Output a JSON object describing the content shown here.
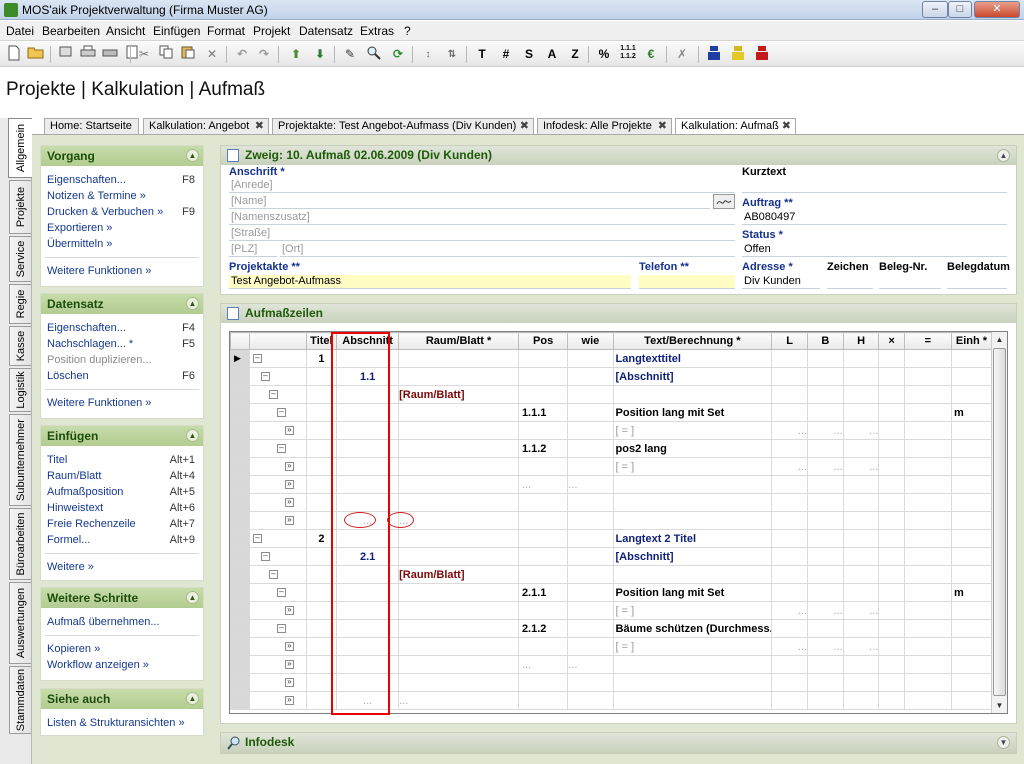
{
  "window": {
    "title": "MOS'aik Projektverwaltung (Firma Muster AG)",
    "min": "–",
    "max": "□",
    "close": "✕"
  },
  "menu": [
    "Datei",
    "Bearbeiten",
    "Ansicht",
    "Einfügen",
    "Format",
    "Projekt",
    "Datensatz",
    "Extras",
    "?"
  ],
  "toolbar": {
    "letters": [
      "T",
      "#",
      "S",
      "A",
      "Z",
      "%",
      "€"
    ]
  },
  "header": {
    "title": "Projekte | Kalkulation | Aufmaß"
  },
  "left_tabs": [
    "Allgemein",
    "Projekte",
    "Service",
    "Regie",
    "Kasse",
    "Logistik",
    "Subunternehmer",
    "Büroarbeiten",
    "Auswertungen",
    "Stammdaten"
  ],
  "tabs": [
    "Home: Startseite",
    "Kalkulation: Angebot",
    "Projektakte: Test Angebot-Aufmass (Div Kunden)",
    "Infodesk: Alle Projekte",
    "Kalkulation: Aufmaß"
  ],
  "sidebar": {
    "vorgang": {
      "title": "Vorgang",
      "items": [
        {
          "label": "Eigenschaften...",
          "key": "F8"
        },
        {
          "label": "Notizen & Termine »",
          "key": ""
        },
        {
          "label": "Drucken & Verbuchen »",
          "key": "F9"
        },
        {
          "label": "Exportieren »",
          "key": ""
        },
        {
          "label": "Übermitteln »",
          "key": ""
        }
      ],
      "more": "Weitere Funktionen »"
    },
    "datensatz": {
      "title": "Datensatz",
      "items": [
        {
          "label": "Eigenschaften...",
          "key": "F4"
        },
        {
          "label": "Nachschlagen... *",
          "key": "F5"
        },
        {
          "label": "Position duplizieren...",
          "key": ""
        },
        {
          "label": "Löschen",
          "key": "F6"
        }
      ],
      "more": "Weitere Funktionen »"
    },
    "einfuegen": {
      "title": "Einfügen",
      "items": [
        {
          "label": "Titel",
          "key": "Alt+1"
        },
        {
          "label": "Raum/Blatt",
          "key": "Alt+4"
        },
        {
          "label": "Aufmaßposition",
          "key": "Alt+5"
        },
        {
          "label": "Hinweistext",
          "key": "Alt+6"
        },
        {
          "label": "Freie Rechenzeile",
          "key": "Alt+7"
        },
        {
          "label": "Formel...",
          "key": "Alt+9"
        }
      ],
      "more": "Weitere »"
    },
    "schritte": {
      "title": "Weitere Schritte",
      "items": [
        "Aufmaß übernehmen...",
        "Kopieren »",
        "Workflow anzeigen »"
      ]
    },
    "siehe": {
      "title": "Siehe auch",
      "items": [
        "Listen & Strukturansichten »"
      ]
    }
  },
  "zweig": {
    "title": "Zweig: 10. Aufmaß 02.06.2009 (Div Kunden)",
    "anschrift_label": "Anschrift *",
    "anrede": "[Anrede]",
    "name": "[Name]",
    "namenszusatz": "[Namenszusatz]",
    "strasse": "[Straße]",
    "plz": "[PLZ]",
    "ort": "[Ort]",
    "kurztext_label": "Kurztext",
    "kurztext": "",
    "auftrag_label": "Auftrag **",
    "auftrag": "AB080497",
    "status_label": "Status *",
    "status": "Offen",
    "projektakte_label": "Projektakte **",
    "projektakte": "Test Angebot-Aufmass",
    "telefon_label": "Telefon **",
    "telefon": "",
    "adresse_label": "Adresse *",
    "adresse": "Div Kunden",
    "zeichen_label": "Zeichen",
    "zeichen": "",
    "belegnr_label": "Beleg-Nr.",
    "belegnr": "",
    "belegdatum_label": "Belegdatum",
    "belegdatum": ""
  },
  "aufmass": {
    "title": "Aufmaßzeilen",
    "columns": [
      "Titel",
      "Abschnitt",
      "Raum/Blatt *",
      "Pos",
      "wie",
      "Text/Berechnung *",
      "L",
      "B",
      "H",
      "×",
      "=",
      "Einh *"
    ],
    "rows": [
      {
        "titel": "1",
        "abschnitt": "",
        "raum": "",
        "pos": "",
        "wie": "",
        "text": "Langtexttitel",
        "einh": "",
        "style": "title"
      },
      {
        "titel": "",
        "abschnitt": "1.1",
        "raum": "",
        "pos": "",
        "wie": "",
        "text": "[Abschnitt]",
        "einh": "",
        "style": "title"
      },
      {
        "titel": "",
        "abschnitt": "",
        "raum": "[Raum/Blatt]",
        "pos": "",
        "wie": "",
        "text": "",
        "einh": "",
        "style": "raum"
      },
      {
        "titel": "",
        "abschnitt": "",
        "raum": "",
        "pos": "1.1.1",
        "wie": "",
        "text": "Position lang mit Set",
        "einh": "m",
        "style": "pos"
      },
      {
        "titel": "",
        "abschnitt": "",
        "raum": "",
        "pos": "",
        "wie": "",
        "text": "[ = ]",
        "einh": "",
        "style": "calc"
      },
      {
        "titel": "",
        "abschnitt": "",
        "raum": "",
        "pos": "1.1.2",
        "wie": "",
        "text": "pos2 lang",
        "einh": "",
        "style": "pos"
      },
      {
        "titel": "",
        "abschnitt": "",
        "raum": "",
        "pos": "",
        "wie": "",
        "text": "[ = ]",
        "einh": "",
        "style": "calc"
      },
      {
        "titel": "",
        "abschnitt": "",
        "raum": "",
        "pos": "...",
        "wie": "...",
        "text": "",
        "einh": "",
        "style": "empty"
      },
      {
        "titel": "",
        "abschnitt": "",
        "raum": "",
        "pos": "",
        "wie": "",
        "text": "",
        "einh": "",
        "style": "empty"
      },
      {
        "titel": "",
        "abschnitt": "...",
        "raum": "...",
        "pos": "",
        "wie": "",
        "text": "",
        "einh": "",
        "style": "empty"
      },
      {
        "titel": "2",
        "abschnitt": "",
        "raum": "",
        "pos": "",
        "wie": "",
        "text": "Langtext 2 Titel",
        "einh": "",
        "style": "title"
      },
      {
        "titel": "",
        "abschnitt": "2.1",
        "raum": "",
        "pos": "",
        "wie": "",
        "text": "[Abschnitt]",
        "einh": "",
        "style": "title"
      },
      {
        "titel": "",
        "abschnitt": "",
        "raum": "[Raum/Blatt]",
        "pos": "",
        "wie": "",
        "text": "",
        "einh": "",
        "style": "raum"
      },
      {
        "titel": "",
        "abschnitt": "",
        "raum": "",
        "pos": "2.1.1",
        "wie": "",
        "text": "Position lang mit Set",
        "einh": "m",
        "style": "pos"
      },
      {
        "titel": "",
        "abschnitt": "",
        "raum": "",
        "pos": "",
        "wie": "",
        "text": "[ = ]",
        "einh": "",
        "style": "calc"
      },
      {
        "titel": "",
        "abschnitt": "",
        "raum": "",
        "pos": "2.1.2",
        "wie": "",
        "text": "Bäume schützen (Durchmess...",
        "einh": "",
        "style": "pos"
      },
      {
        "titel": "",
        "abschnitt": "",
        "raum": "",
        "pos": "",
        "wie": "",
        "text": "[ = ]",
        "einh": "",
        "style": "calc"
      },
      {
        "titel": "",
        "abschnitt": "",
        "raum": "",
        "pos": "...",
        "wie": "...",
        "text": "",
        "einh": "",
        "style": "empty"
      },
      {
        "titel": "",
        "abschnitt": "",
        "raum": "",
        "pos": "",
        "wie": "",
        "text": "",
        "einh": "",
        "style": "empty"
      },
      {
        "titel": "",
        "abschnitt": "...",
        "raum": "...",
        "pos": "",
        "wie": "",
        "text": "",
        "einh": "",
        "style": "empty"
      }
    ]
  },
  "infodesk": {
    "title": "Infodesk"
  }
}
